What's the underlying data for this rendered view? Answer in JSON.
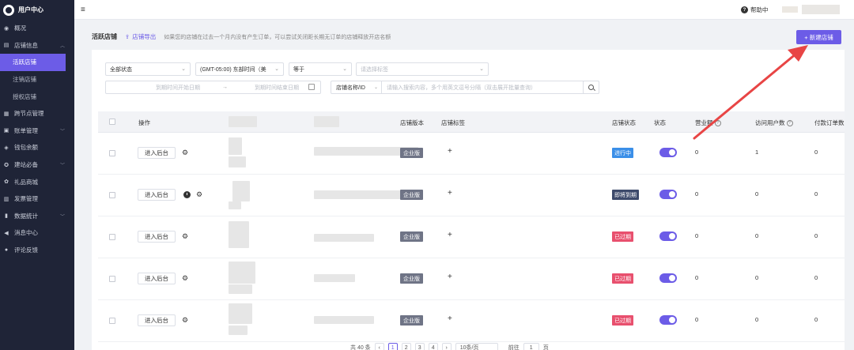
{
  "sidebar": {
    "title": "用户中心",
    "items": [
      {
        "label": "概况",
        "icon": "gauge-icon"
      },
      {
        "label": "店铺信息",
        "icon": "store-icon",
        "expanded": true,
        "children": [
          {
            "label": "活跃店铺",
            "active": true
          },
          {
            "label": "注销店铺"
          },
          {
            "label": "授权店铺"
          }
        ]
      },
      {
        "label": "跨节点管理",
        "icon": "node-icon"
      },
      {
        "label": "账单管理",
        "icon": "bill-icon"
      },
      {
        "label": "钱包余额",
        "icon": "wallet-icon"
      },
      {
        "label": "建站必备",
        "icon": "toolbox-icon"
      },
      {
        "label": "礼品商城",
        "icon": "gift-icon"
      },
      {
        "label": "发票管理",
        "icon": "invoice-icon"
      },
      {
        "label": "数据统计",
        "icon": "chart-icon"
      },
      {
        "label": "消息中心",
        "icon": "megaphone-icon"
      },
      {
        "label": "评论反馈",
        "icon": "comment-icon"
      }
    ]
  },
  "topbar": {
    "help_label": "帮助中"
  },
  "header": {
    "title": "活跃店铺",
    "export_label": "店铺导出",
    "hint": "如果您的店铺在过去一个月内没有产生订单，可以尝试关闭距长期无订单的店铺释放开店名额",
    "new_button": "+ 新建店铺"
  },
  "filters": {
    "status": "全部状态",
    "timezone": "(GMT-05:00) 东部时间（美",
    "compare": "等于",
    "tag_placeholder": "请选择标签",
    "date_start_placeholder": "到期时间开始日期",
    "date_sep": "→",
    "date_end_placeholder": "到期时间结束日期",
    "search_field": "店铺名称/ID",
    "search_placeholder": "请输入搜索内容，多个用英文逗号分隔（双击展开批量查询）"
  },
  "table": {
    "headers": {
      "actions": "操作",
      "version": "店铺版本",
      "tags": "店铺标签",
      "store_status": "店铺状态",
      "state": "状态",
      "revenue": "营业额",
      "visitors": "访问用户数",
      "paid_orders": "付款订单数"
    },
    "enter_label": "进入后台",
    "rows": [
      {
        "version": "企业版",
        "status": "进行中",
        "status_color": "#3b8fe8",
        "clock": false,
        "revenue": "0",
        "visitors": "1",
        "orders": "0"
      },
      {
        "version": "企业版",
        "status": "即将到期",
        "status_color": "#3d4a6b",
        "clock": true,
        "revenue": "0",
        "visitors": "0",
        "orders": "0"
      },
      {
        "version": "企业版",
        "status": "已过期",
        "status_color": "#e8506e",
        "clock": false,
        "revenue": "0",
        "visitors": "0",
        "orders": "0"
      },
      {
        "version": "企业版",
        "status": "已过期",
        "status_color": "#e8506e",
        "clock": false,
        "revenue": "0",
        "visitors": "0",
        "orders": "0"
      },
      {
        "version": "企业版",
        "status": "已过期",
        "status_color": "#e8506e",
        "clock": false,
        "revenue": "0",
        "visitors": "0",
        "orders": "0"
      }
    ]
  },
  "pagination": {
    "total": "共 40 条",
    "pages": [
      "1",
      "2",
      "3",
      "4"
    ],
    "page_size": "10条/页",
    "goto_label": "前往",
    "goto_value": "1",
    "page_unit": "页"
  },
  "colors": {
    "accent": "#6c5ce7",
    "sidebar_bg": "#1f2437",
    "annotation_arrow": "#e84545"
  }
}
